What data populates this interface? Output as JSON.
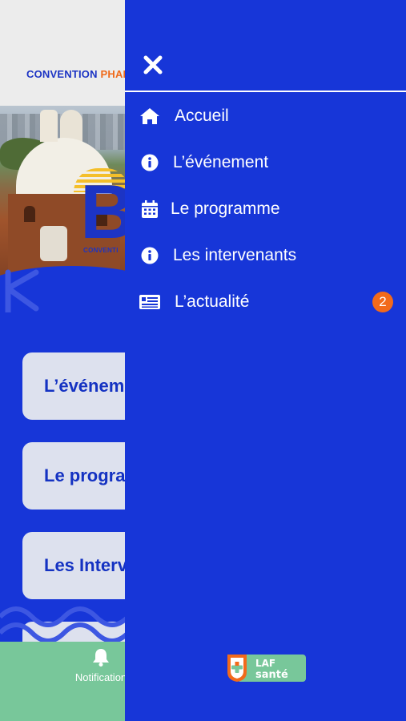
{
  "app": {
    "brand_part1": "CONVENTION ",
    "brand_part2": "PHAR",
    "hero_mini_text": "CONVENTI",
    "hero_letter": "B",
    "buttons": [
      {
        "label": "L’événem"
      },
      {
        "label": "Le progra"
      },
      {
        "label": "Les Interv"
      },
      {
        "label": ""
      }
    ],
    "tabbar": {
      "notifications_label": "Notification"
    }
  },
  "drawer": {
    "close_icon": "close-icon",
    "items": [
      {
        "label": "Accueil",
        "icon": "home-icon"
      },
      {
        "label": "L’événement",
        "icon": "info-icon"
      },
      {
        "label": "Le programme",
        "icon": "calendar-icon"
      },
      {
        "label": "Les intervenants",
        "icon": "info-icon"
      },
      {
        "label": "L’actualité",
        "icon": "news-icon",
        "badge": "2"
      }
    ],
    "logo_text_top": "LAF",
    "logo_text_bottom": "santé"
  },
  "colors": {
    "primary": "#1736d8",
    "accent_orange": "#f26a1b",
    "tabbar_green": "#78c79a",
    "button_bg": "#dde1ee",
    "header_bg": "#ececec"
  }
}
